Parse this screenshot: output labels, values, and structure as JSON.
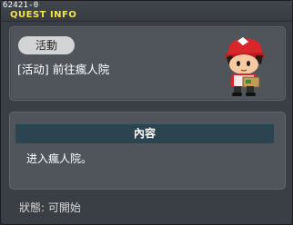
{
  "window": {
    "quest_id": "62421-0",
    "title": "QUEST INFO"
  },
  "quest": {
    "category": "活動",
    "name": "[活动] 前往瘋人院",
    "npc_icon": "npc-character-icon"
  },
  "content": {
    "header": "內容",
    "text": "进入瘋人院。"
  },
  "status": {
    "text": "狀態: 可開始"
  },
  "colors": {
    "title_yellow": "#f2e64a",
    "panel": "#50555c",
    "header_bar": "#2c4450"
  }
}
